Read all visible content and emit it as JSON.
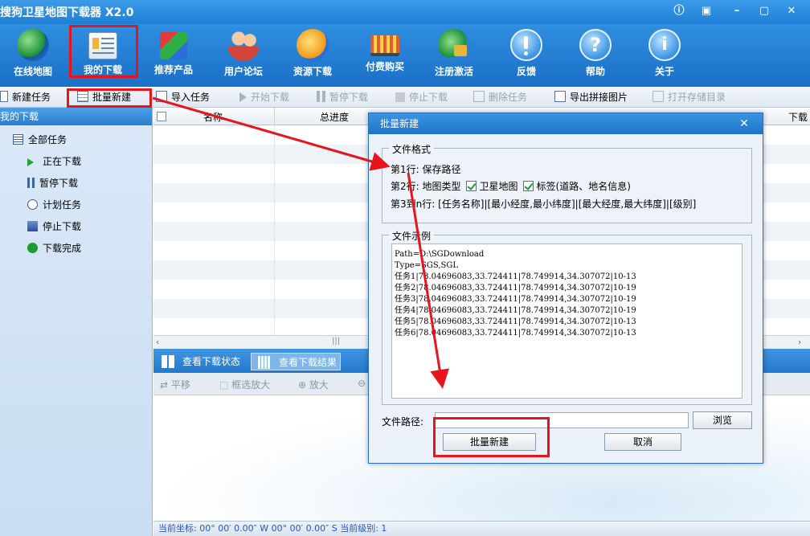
{
  "window": {
    "title": "搜狗卫星地图下载器 X2.0"
  },
  "main_toolbar": {
    "items": [
      {
        "label": "在线地图"
      },
      {
        "label": "我的下载"
      },
      {
        "label": "推荐产品"
      },
      {
        "label": "用户论坛"
      },
      {
        "label": "资源下载"
      },
      {
        "label": "付费购买"
      },
      {
        "label": "注册激活"
      },
      {
        "label": "反馈"
      },
      {
        "label": "帮助"
      },
      {
        "label": "关于"
      }
    ]
  },
  "command_bar": {
    "new_task": "新建任务",
    "batch_new": "批量新建",
    "import_task": "导入任务",
    "start_download": "开始下载",
    "pause_download": "暂停下载",
    "stop_download": "停止下载",
    "delete_task": "删除任务",
    "export_mosaic": "导出拼接图片",
    "open_storage": "打开存储目录"
  },
  "sidebar": {
    "header": "我的下载",
    "root": "全部任务",
    "items": [
      "正在下载",
      "暂停下载",
      "计划任务",
      "停止下载",
      "下载完成"
    ]
  },
  "table": {
    "columns": [
      "名称",
      "总进度",
      "下载"
    ]
  },
  "lower_tabs": {
    "status_tab": "查看下载状态",
    "result_tab": "查看下载结果"
  },
  "map_tools": {
    "pan": "平移",
    "box_zoom": "框选放大",
    "zoom_in": "放大"
  },
  "status_bar": {
    "text": "当前坐标:    00° 00′  0.00″ W 00° 00′  0.00″ S   当前级别: 1"
  },
  "dialog": {
    "title": "批量新建",
    "format_group": "文件格式",
    "line1": "第1行: 保存路径",
    "line2_prefix": "第2行: 地图类型",
    "line2_sat": "卫星地图",
    "line2_label": "标签(道路、地名信息)",
    "line3": "第3到n行: [任务名称]|[最小经度,最小纬度]|[最大经度,最大纬度]|[级别]",
    "example_group": "文件示例",
    "example_lines": [
      "Path=D:\\SGDownload",
      "Type=SGS,SGL",
      "任务1|78.04696083,33.724411|78.749914,34.307072|10-13",
      "任务2|78.04696083,33.724411|78.749914,34.307072|10-19",
      "任务3|78.04696083,33.724411|78.749914,34.307072|10-19",
      "任务4|78.04696083,33.724411|78.749914,34.307072|10-19",
      "任务5|78.04696083,33.724411|78.749914,34.307072|10-13",
      "任务6|78.04696083,33.724411|78.749914,34.307072|10-13"
    ],
    "file_path_label": "文件路径:",
    "file_path_value": "",
    "browse": "浏览",
    "confirm": "批量新建",
    "cancel": "取消"
  },
  "colors": {
    "accent": "#1f7fd6",
    "highlight": "#e8141c"
  }
}
